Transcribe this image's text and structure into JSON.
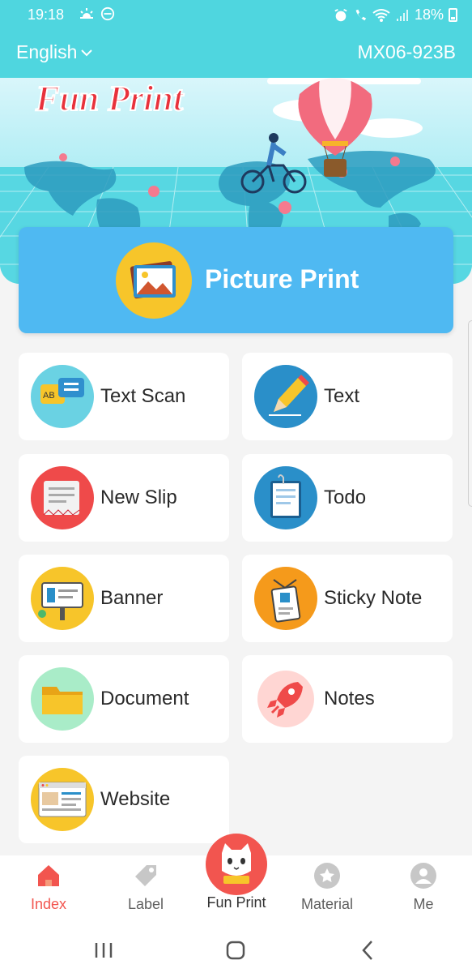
{
  "status_bar": {
    "time": "19:18",
    "left_icons": [
      "weather-icon",
      "do-not-disturb-icon"
    ],
    "right_icons": [
      "alarm-icon",
      "wifi-call-icon",
      "wifi-icon",
      "signal-icon"
    ],
    "battery": "18%"
  },
  "header": {
    "language": "English",
    "device": "MX06-923B"
  },
  "banner": {
    "logo_text": "Fun Print"
  },
  "picture_print": {
    "label": "Picture Print",
    "icon": "picture-icon"
  },
  "tiles": [
    {
      "label": "Text Scan",
      "icon": "text-scan-icon",
      "color": "#6ad2e3"
    },
    {
      "label": "Text",
      "icon": "pencil-icon",
      "color": "#2a8fc9"
    },
    {
      "label": "New Slip",
      "icon": "slip-icon",
      "color": "#ef4a4a"
    },
    {
      "label": "Todo",
      "icon": "clipboard-icon",
      "color": "#2a8fc9"
    },
    {
      "label": "Banner",
      "icon": "billboard-icon",
      "color": "#f7c52a"
    },
    {
      "label": "Sticky Note",
      "icon": "badge-icon",
      "color": "#f59a1b"
    },
    {
      "label": "Document",
      "icon": "folder-icon",
      "color": "#a9ecc8"
    },
    {
      "label": "Notes",
      "icon": "rocket-icon",
      "color": "#ffd6d3"
    },
    {
      "label": "Website",
      "icon": "browser-icon",
      "color": "#f7c52a"
    }
  ],
  "bottom_nav": [
    {
      "label": "Index",
      "icon": "home-icon",
      "active": true
    },
    {
      "label": "Label",
      "icon": "tag-icon",
      "active": false
    },
    {
      "label": "Fun Print",
      "icon": "cat-icon",
      "active": false
    },
    {
      "label": "Material",
      "icon": "star-icon",
      "active": false
    },
    {
      "label": "Me",
      "icon": "user-icon",
      "active": false
    }
  ],
  "system_nav": [
    "recent-apps-icon",
    "home-button-icon",
    "back-icon"
  ],
  "colors": {
    "accent": "#4fd6df",
    "picture_card": "#4fb9f2",
    "active": "#f2554f"
  }
}
